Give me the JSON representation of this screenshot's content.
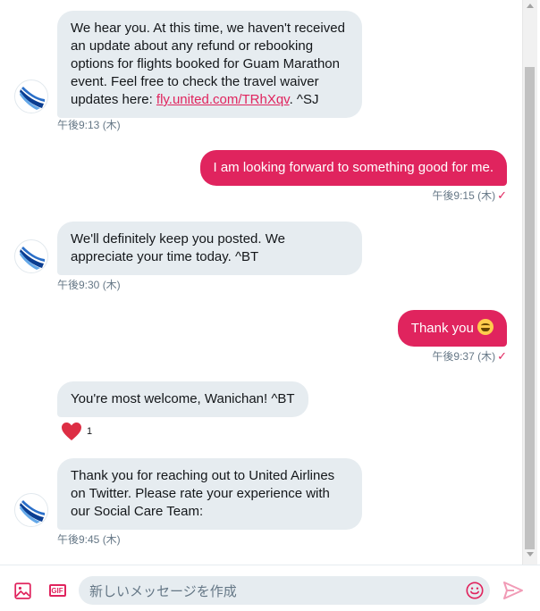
{
  "colors": {
    "accent": "#e0245e",
    "incoming_bg": "#e6ecf0",
    "meta": "#657786"
  },
  "messages": [
    {
      "direction": "incoming",
      "text_before_link": "We hear you. At this time, we haven't received an update about any refund or rebooking options for flights booked for Guam Marathon event. Feel free to check the travel waiver updates here: ",
      "link": "fly.united.com/TRhXqv",
      "text_after_link": ". ^SJ",
      "time": "午後9:13 (木)"
    },
    {
      "direction": "outgoing",
      "text": "I am looking forward to something good for me.",
      "time": "午後9:15 (木)",
      "status_icon": "check-icon"
    },
    {
      "direction": "incoming",
      "text": "We'll definitely keep you posted. We appreciate your time today. ^BT",
      "time": "午後9:30 (木)"
    },
    {
      "direction": "outgoing",
      "text": "Thank you",
      "emoji": "grinning-face-icon",
      "time": "午後9:37 (木)",
      "status_icon": "check-icon"
    },
    {
      "direction": "incoming",
      "text": "You're most welcome, Wanichan! ^BT",
      "reaction": {
        "icon": "heart-icon",
        "count": "1"
      }
    },
    {
      "direction": "incoming",
      "text": "Thank you for reaching out to United Airlines on Twitter. Please rate your experience with our Social Care Team:",
      "time": "午後9:45 (木)"
    }
  ],
  "composer": {
    "placeholder": "新しいメッセージを作成",
    "media_icon": "image-icon",
    "gif_label": "GIF",
    "emoji_icon": "smiley-icon",
    "send_icon": "send-icon"
  }
}
